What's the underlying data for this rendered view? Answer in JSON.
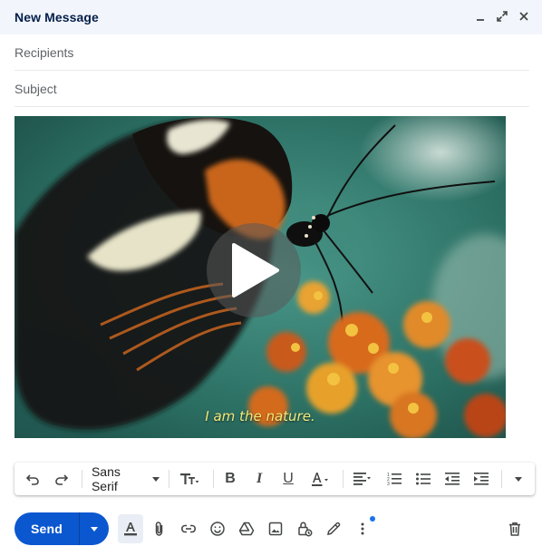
{
  "window": {
    "title": "New Message"
  },
  "fields": {
    "recipients_placeholder": "Recipients",
    "subject_placeholder": "Subject"
  },
  "video": {
    "caption": "I am the nature."
  },
  "format_toolbar": {
    "font_family": "Sans Serif",
    "bold_label": "B",
    "italic_label": "I",
    "underline_label": "U",
    "items": [
      "undo-icon",
      "redo-icon",
      "font-family-select",
      "text-size-icon",
      "bold",
      "italic",
      "underline",
      "text-color-icon",
      "align-icon",
      "numbered-list-icon",
      "bulleted-list-icon",
      "indent-less-icon",
      "indent-more-icon",
      "more-formatting-icon"
    ]
  },
  "bottom_bar": {
    "send_label": "Send",
    "icons": [
      "formatting-options-icon",
      "attach-icon",
      "link-icon",
      "emoji-icon",
      "drive-icon",
      "photo-icon",
      "confidential-mode-icon",
      "signature-icon",
      "more-options-icon",
      "discard-trash-icon"
    ]
  },
  "colors": {
    "header_bg": "#f2f6fc",
    "title_text": "#041e49",
    "send_button": "#0b57d0",
    "caption_text": "#f3e97a"
  }
}
